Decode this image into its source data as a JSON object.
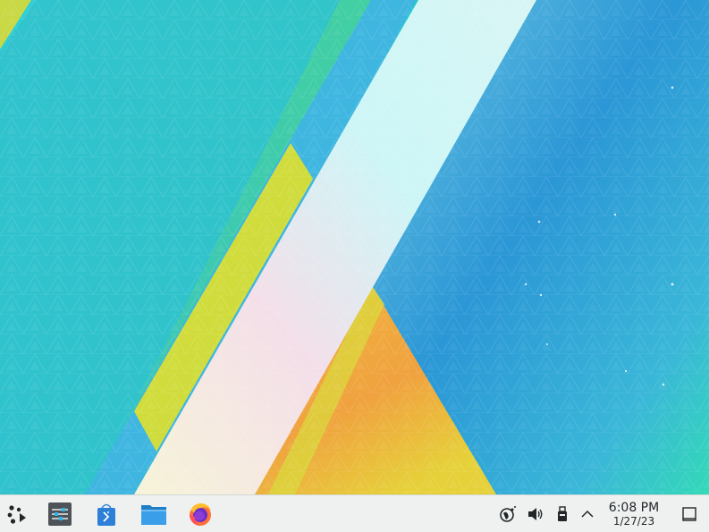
{
  "desktop": {
    "wallpaper_name": "kde-plasma-default-wallpaper",
    "colors": {
      "teal": "#2fc6cf",
      "blue": "#3aa6dc",
      "yellow": "#d6dc3c",
      "orange": "#f0a83c",
      "white_stripe": "#eaf7f6",
      "green": "#35d39b"
    }
  },
  "taskbar": {
    "launcher": {
      "icon": "plasma-launcher-icon"
    },
    "tasks": [
      {
        "icon": "system-settings-icon"
      },
      {
        "icon": "discover-store-icon"
      },
      {
        "icon": "dolphin-folder-icon"
      },
      {
        "icon": "firefox-icon"
      }
    ],
    "tray": [
      {
        "icon": "network-icon"
      },
      {
        "icon": "volume-icon"
      },
      {
        "icon": "usb-device-icon"
      },
      {
        "icon": "chevron-up-icon"
      }
    ],
    "clock": {
      "time": "6:08 PM",
      "date": "1/27/23"
    },
    "show_desktop": {
      "icon": "show-desktop-icon"
    }
  }
}
